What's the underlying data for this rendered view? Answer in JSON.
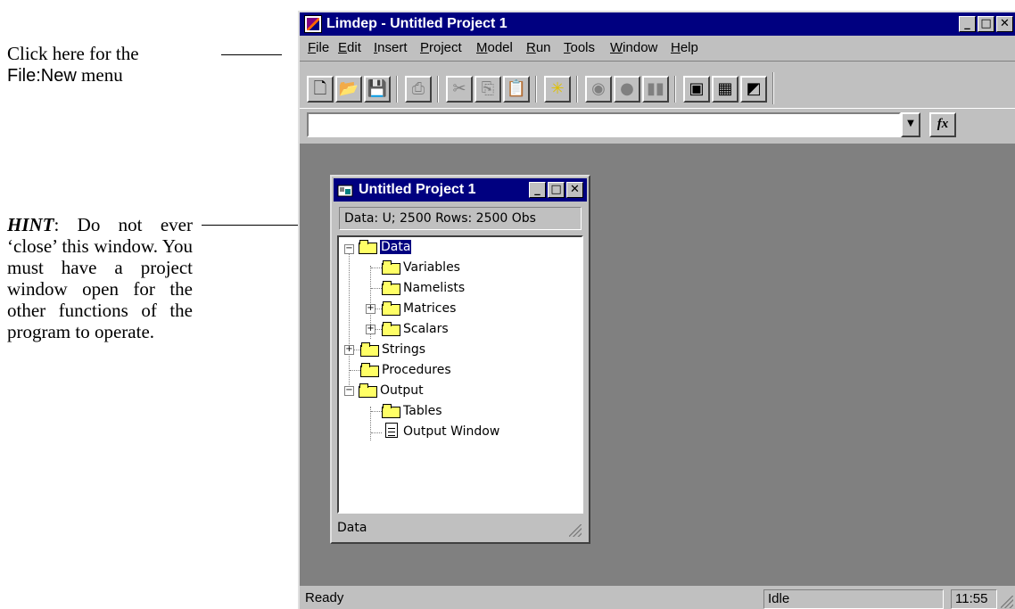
{
  "annotations": {
    "file_new": {
      "prefix": "Click here for the",
      "menu": "File:New",
      "suffix": "menu"
    },
    "hint": {
      "label": "HINT",
      "text": ": Do not ever ‘close’ this window. You must have a project window open for the other functions of the program to operate."
    }
  },
  "app": {
    "title": "Limdep - Untitled Project 1",
    "window_buttons": {
      "minimize": "_",
      "maximize": "□",
      "close": "✕"
    }
  },
  "menu": [
    {
      "label": "File",
      "key": "F",
      "rest": "ile"
    },
    {
      "label": "Edit",
      "key": "E",
      "rest": "dit"
    },
    {
      "label": "Insert",
      "key": "I",
      "rest": "nsert"
    },
    {
      "label": "Project",
      "key": "P",
      "rest": "roject"
    },
    {
      "label": "Model",
      "key": "M",
      "rest": "odel"
    },
    {
      "label": "Run",
      "key": "R",
      "rest": "un"
    },
    {
      "label": "Tools",
      "key": "T",
      "rest": "ools"
    },
    {
      "label": "Window",
      "key": "W",
      "rest": "indow"
    },
    {
      "label": "Help",
      "key": "H",
      "rest": "elp"
    }
  ],
  "toolbar": {
    "icons": [
      "new-file-icon",
      "open-folder-icon",
      "save-icon",
      "print-icon",
      "cut-icon",
      "copy-icon",
      "paste-icon",
      "star-icon",
      "go-icon",
      "stop-icon",
      "pause-icon",
      "project-icon",
      "grid-icon",
      "chart-icon"
    ]
  },
  "command_bar": {
    "value": "",
    "fx_label": "fx"
  },
  "status_bar": {
    "ready": "Ready",
    "state": "Idle",
    "time": "11:55"
  },
  "project_window": {
    "title": "Untitled Project 1",
    "info": "Data: U; 2500 Rows: 2500 Obs",
    "tree": {
      "data": "Data",
      "variables": "Variables",
      "namelists": "Namelists",
      "matrices": "Matrices",
      "scalars": "Scalars",
      "strings": "Strings",
      "procedures": "Procedures",
      "output": "Output",
      "tables": "Tables",
      "output_window": "Output Window"
    },
    "status": "Data"
  },
  "colors": {
    "titlebar": "#000080",
    "face": "#c0c0c0",
    "mdi_background": "#808080",
    "selection": "#000080"
  }
}
